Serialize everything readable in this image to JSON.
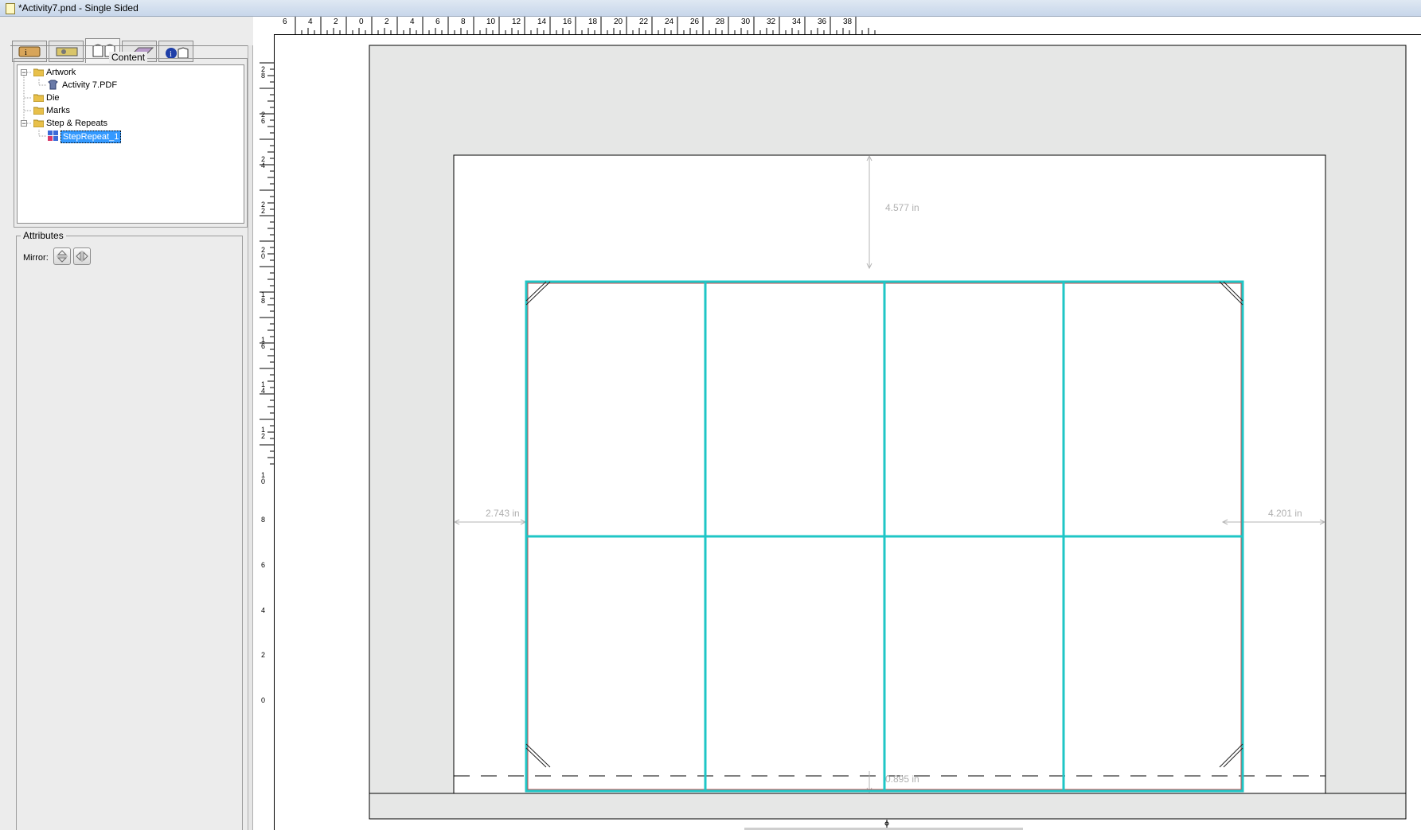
{
  "window": {
    "title": "*Activity7.pnd - Single Sided"
  },
  "tabs": [
    {
      "icon": "job-info-icon"
    },
    {
      "icon": "press-info-icon"
    },
    {
      "icon": "content-icon",
      "active": true
    },
    {
      "icon": "layout-icon"
    },
    {
      "icon": "product-info-icon"
    }
  ],
  "content_panel": {
    "title": "Content",
    "tree": [
      {
        "label": "Artwork",
        "expanded": true
      },
      {
        "label": "Activity 7.PDF"
      },
      {
        "label": "Die"
      },
      {
        "label": "Marks"
      },
      {
        "label": "Step & Repeats",
        "expanded": true
      },
      {
        "label": "StepRepeat_1",
        "selected": true
      }
    ]
  },
  "attributes_panel": {
    "title": "Attributes",
    "mirror_label": "Mirror:"
  },
  "rulers": {
    "top_labels": [
      "6",
      "4",
      "2",
      "0",
      "2",
      "4",
      "6",
      "8",
      "10",
      "12",
      "14",
      "16",
      "18",
      "20",
      "22",
      "24",
      "26",
      "28",
      "30",
      "32",
      "34",
      "36",
      "38"
    ],
    "left_labels": [
      "28",
      "26",
      "24",
      "22",
      "20",
      "18",
      "16",
      "14",
      "12",
      "10",
      "8",
      "6",
      "4",
      "2",
      "0"
    ]
  },
  "canvas": {
    "step_repeat": {
      "columns": 4,
      "rows": 2,
      "color": "#1fc6c6"
    },
    "dimensions": {
      "top": "4.577 in",
      "left": "2.743 in",
      "right": "4.201 in",
      "bottom": "0.895 in"
    }
  }
}
